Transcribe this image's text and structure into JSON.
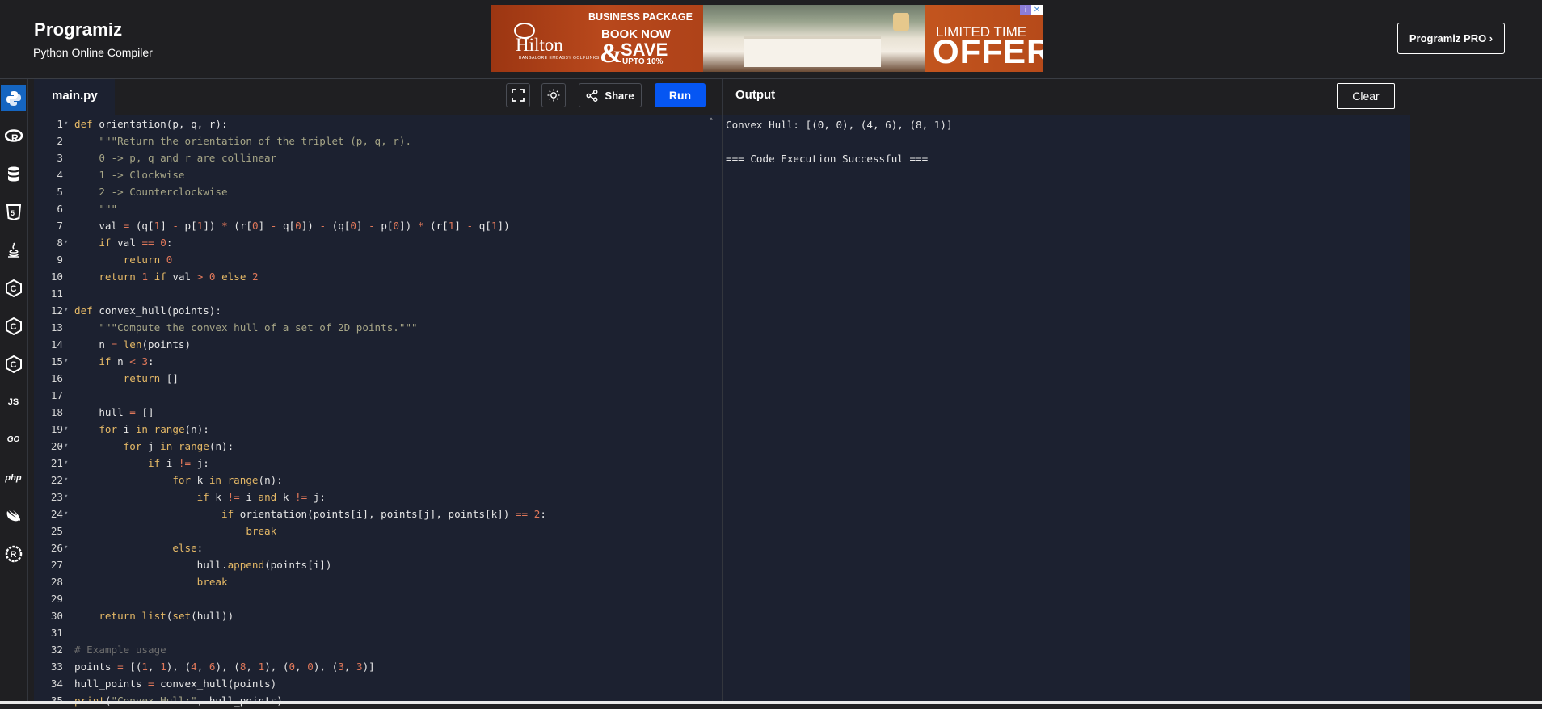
{
  "header": {
    "logo": "Programiz",
    "subtitle": "Python Online Compiler",
    "pro_button": "Programiz PRO ›"
  },
  "ad": {
    "brand": "Hilton",
    "brand_sub": "BANGALORE EMBASSY GOLFLINKS",
    "package": "BUSINESS PACKAGE",
    "book": "BOOK NOW",
    "amp": "&",
    "save": "SAVE",
    "upto": "UPTO 10%",
    "limited": "LIMITED TIME",
    "offer": "OFFER"
  },
  "rail": {
    "icons": [
      "python-icon",
      "r-icon",
      "database-icon",
      "html5-icon",
      "java-icon",
      "c-icon",
      "cplusplus-icon",
      "csharp-icon",
      "js-icon",
      "go-icon",
      "php-icon",
      "swift-icon",
      "rust-icon"
    ],
    "labels": {
      "js": "JS",
      "go": "GO",
      "php": "php"
    }
  },
  "editor": {
    "tab": "main.py",
    "share": "Share",
    "run": "Run",
    "lines": [
      "def orientation(p, q, r):",
      "    \"\"\"Return the orientation of the triplet (p, q, r).",
      "    0 -> p, q and r are collinear",
      "    1 -> Clockwise",
      "    2 -> Counterclockwise",
      "    \"\"\"",
      "    val = (q[1] - p[1]) * (r[0] - q[0]) - (q[0] - p[0]) * (r[1] - q[1])",
      "    if val == 0:",
      "        return 0",
      "    return 1 if val > 0 else 2",
      "",
      "def convex_hull(points):",
      "    \"\"\"Compute the convex hull of a set of 2D points.\"\"\"",
      "    n = len(points)",
      "    if n < 3:",
      "        return []",
      "",
      "    hull = []",
      "    for i in range(n):",
      "        for j in range(n):",
      "            if i != j:",
      "                for k in range(n):",
      "                    if k != i and k != j:",
      "                        if orientation(points[i], points[j], points[k]) == 2:",
      "                            break",
      "                else:",
      "                    hull.append(points[i])",
      "                    break",
      "",
      "    return list(set(hull))",
      "",
      "# Example usage",
      "points = [(1, 1), (4, 6), (8, 1), (0, 0), (3, 3)]",
      "hull_points = convex_hull(points)",
      "print(\"Convex Hull:\", hull_points)"
    ],
    "folds": [
      1,
      8,
      12,
      15,
      19,
      20,
      21,
      22,
      23,
      24,
      26
    ]
  },
  "output": {
    "title": "Output",
    "clear": "Clear",
    "lines": [
      "Convex Hull: [(0, 0), (4, 6), (8, 1)]",
      "",
      "=== Code Execution Successful ==="
    ]
  }
}
